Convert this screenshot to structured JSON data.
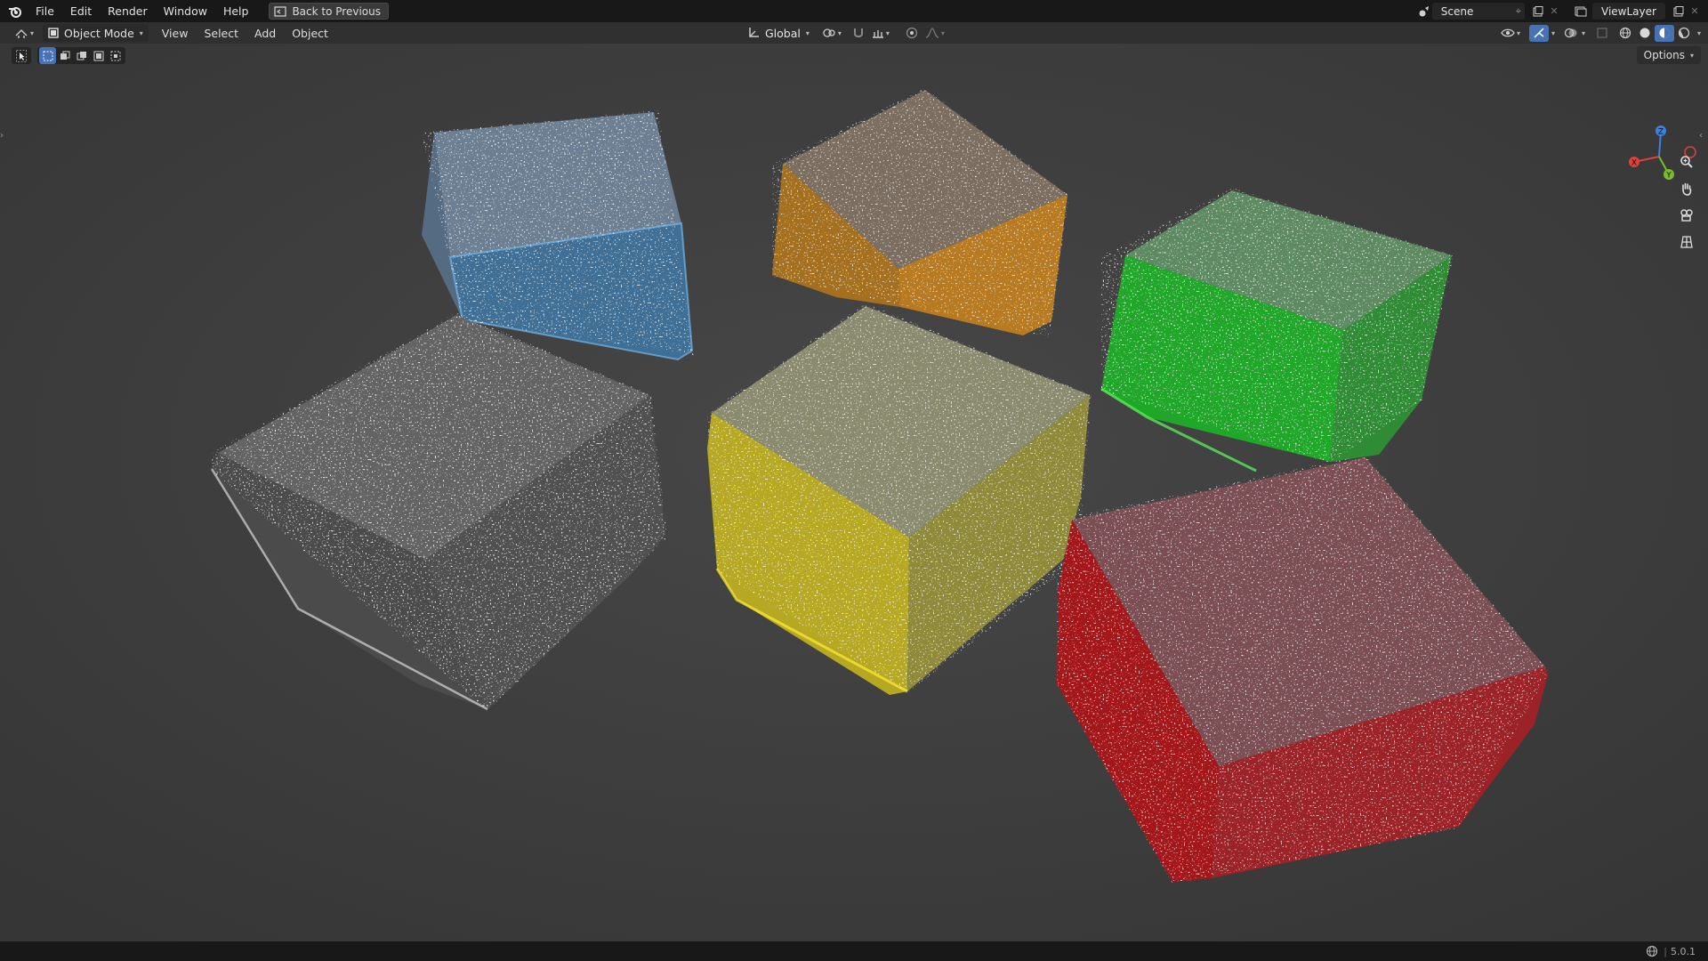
{
  "topbar": {
    "menus": [
      "File",
      "Edit",
      "Render",
      "Window",
      "Help"
    ],
    "back_button": "Back to Previous",
    "scene": "Scene",
    "view_layer": "ViewLayer"
  },
  "header": {
    "mode": "Object Mode",
    "menus": [
      "View",
      "Select",
      "Add",
      "Object"
    ],
    "transform_orientation": "Global"
  },
  "toolrow": {
    "options_label": "Options"
  },
  "gizmo": {
    "x": "X",
    "y": "Y",
    "z": "Z"
  },
  "status": {
    "version": "5.0.1"
  },
  "colors": {
    "topbar_bg": "#181818",
    "header_bg": "#303030",
    "viewport_bg": "#3d3d3d",
    "accent": "#4772b3",
    "axis_x": "#e0413a",
    "axis_y": "#7dbb2e",
    "axis_z": "#3b82e0"
  },
  "scene_objects": [
    {
      "name": "blue-jelly-cube",
      "color": "#4f8fbf"
    },
    {
      "name": "orange-jelly-cube",
      "color": "#c8862a"
    },
    {
      "name": "green-jelly-cube",
      "color": "#22b52a"
    },
    {
      "name": "clear-jelly-cube",
      "color": "#9a9a9a"
    },
    {
      "name": "yellow-jelly-cube",
      "color": "#d0c21e"
    },
    {
      "name": "red-jelly-cube",
      "color": "#c0181a"
    }
  ]
}
